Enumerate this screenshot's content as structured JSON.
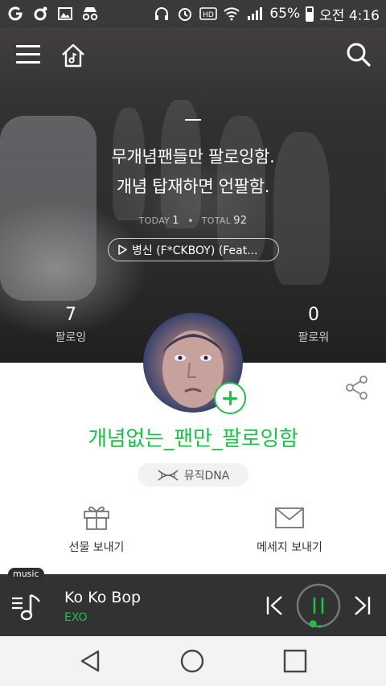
{
  "status_bar": {
    "battery": "65%",
    "time": "오전 4:16",
    "icons": [
      "app-g-icon",
      "app-o-icon",
      "image-icon",
      "incognito-icon",
      "headset-icon",
      "alarm-icon",
      "hd-icon",
      "wifi-icon",
      "signal-icon",
      "battery-icon"
    ]
  },
  "header": {
    "icons": [
      "menu-icon",
      "home-music-icon",
      "search-icon"
    ]
  },
  "profile": {
    "bio_line1": "무개념팬들만 팔로잉함.",
    "bio_line2": "개념 탑재하면 언팔함.",
    "today_label": "TODAY",
    "today_count": "1",
    "total_label": "TOTAL",
    "total_count": "92",
    "song": "병신 (F*CKBOY) (Feat...",
    "following_count": "7",
    "following_label": "팔로잉",
    "followers_count": "0",
    "followers_label": "팔로워",
    "nickname": "개념없는_팬만_팔로잉함",
    "dna_label": "뮤직DNA"
  },
  "actions": {
    "gift_label": "선물 보내기",
    "message_label": "메세지 보내기"
  },
  "player": {
    "tag": "music",
    "title": "Ko Ko Bop",
    "artist": "EXO",
    "progress": 0.02
  },
  "colors": {
    "accent": "#1fc04a",
    "player_bg": "#323232",
    "status_bg": "#3a3a3a"
  }
}
